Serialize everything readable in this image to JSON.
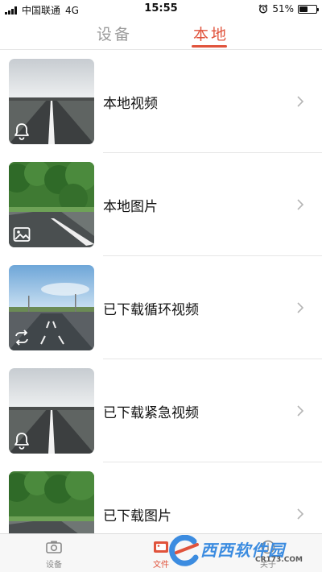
{
  "status_bar": {
    "carrier": "中国联通",
    "network": "4G",
    "time": "15:55",
    "battery_percent_label": "51%",
    "battery_level": 0.51
  },
  "tabs": [
    {
      "label": "设备",
      "active": false
    },
    {
      "label": "本地",
      "active": true
    }
  ],
  "items": [
    {
      "label": "本地视频",
      "thumb": "road-gray",
      "badge_icon": "bell-icon"
    },
    {
      "label": "本地图片",
      "thumb": "road-trees",
      "badge_icon": "image-icon"
    },
    {
      "label": "已下载循环视频",
      "thumb": "road-sky",
      "badge_icon": "loop-icon"
    },
    {
      "label": "已下载紧急视频",
      "thumb": "road-gray",
      "badge_icon": "bell-icon"
    },
    {
      "label": "已下载图片",
      "thumb": "road-trees",
      "badge_icon": "image-icon"
    }
  ],
  "bottom_nav": [
    {
      "label": "设备",
      "icon": "camera-icon",
      "active": false
    },
    {
      "label": "文件",
      "icon": "folder-icon",
      "active": true
    },
    {
      "label": "关于",
      "icon": "info-icon",
      "active": false
    }
  ],
  "watermark": {
    "text": "西西软件园",
    "sub": "CR173.COM"
  },
  "colors": {
    "accent": "#e0533c",
    "inactive": "#9a9a9a",
    "divider": "#e6e6e6"
  }
}
